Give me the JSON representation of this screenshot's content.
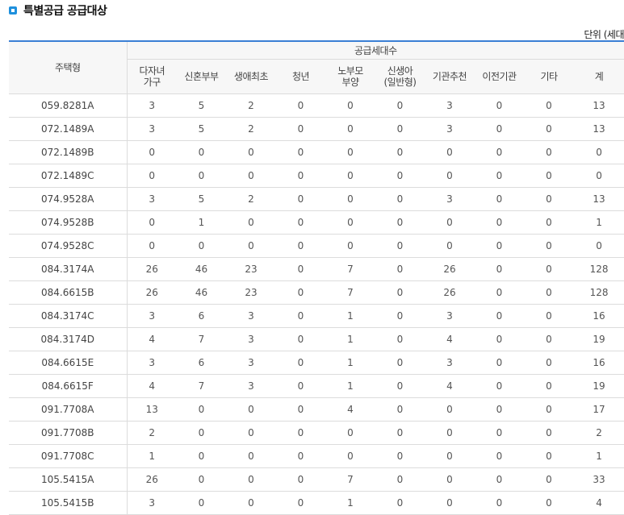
{
  "header": {
    "title": "특별공급 공급대상",
    "unit": "단위 (세대"
  },
  "table": {
    "row_header": "주택형",
    "group_header": "공급세대수",
    "columns": [
      [
        "다자녀",
        "가구"
      ],
      [
        "신혼부부"
      ],
      [
        "생애최초"
      ],
      [
        "청년"
      ],
      [
        "노부모",
        "부양"
      ],
      [
        "신생아",
        "(일반형)"
      ],
      [
        "기관추천"
      ],
      [
        "이전기관"
      ],
      [
        "기타"
      ],
      [
        "계"
      ]
    ],
    "rows": [
      {
        "type": "059.8281A",
        "values": [
          "3",
          "5",
          "2",
          "0",
          "0",
          "0",
          "3",
          "0",
          "0",
          "13"
        ]
      },
      {
        "type": "072.1489A",
        "values": [
          "3",
          "5",
          "2",
          "0",
          "0",
          "0",
          "3",
          "0",
          "0",
          "13"
        ]
      },
      {
        "type": "072.1489B",
        "values": [
          "0",
          "0",
          "0",
          "0",
          "0",
          "0",
          "0",
          "0",
          "0",
          "0"
        ]
      },
      {
        "type": "072.1489C",
        "values": [
          "0",
          "0",
          "0",
          "0",
          "0",
          "0",
          "0",
          "0",
          "0",
          "0"
        ]
      },
      {
        "type": "074.9528A",
        "values": [
          "3",
          "5",
          "2",
          "0",
          "0",
          "0",
          "3",
          "0",
          "0",
          "13"
        ]
      },
      {
        "type": "074.9528B",
        "values": [
          "0",
          "1",
          "0",
          "0",
          "0",
          "0",
          "0",
          "0",
          "0",
          "1"
        ]
      },
      {
        "type": "074.9528C",
        "values": [
          "0",
          "0",
          "0",
          "0",
          "0",
          "0",
          "0",
          "0",
          "0",
          "0"
        ]
      },
      {
        "type": "084.3174A",
        "values": [
          "26",
          "46",
          "23",
          "0",
          "7",
          "0",
          "26",
          "0",
          "0",
          "128"
        ]
      },
      {
        "type": "084.6615B",
        "values": [
          "26",
          "46",
          "23",
          "0",
          "7",
          "0",
          "26",
          "0",
          "0",
          "128"
        ]
      },
      {
        "type": "084.3174C",
        "values": [
          "3",
          "6",
          "3",
          "0",
          "1",
          "0",
          "3",
          "0",
          "0",
          "16"
        ]
      },
      {
        "type": "084.3174D",
        "values": [
          "4",
          "7",
          "3",
          "0",
          "1",
          "0",
          "4",
          "0",
          "0",
          "19"
        ]
      },
      {
        "type": "084.6615E",
        "values": [
          "3",
          "6",
          "3",
          "0",
          "1",
          "0",
          "3",
          "0",
          "0",
          "16"
        ]
      },
      {
        "type": "084.6615F",
        "values": [
          "4",
          "7",
          "3",
          "0",
          "1",
          "0",
          "4",
          "0",
          "0",
          "19"
        ]
      },
      {
        "type": "091.7708A",
        "values": [
          "13",
          "0",
          "0",
          "0",
          "4",
          "0",
          "0",
          "0",
          "0",
          "17"
        ]
      },
      {
        "type": "091.7708B",
        "values": [
          "2",
          "0",
          "0",
          "0",
          "0",
          "0",
          "0",
          "0",
          "0",
          "2"
        ]
      },
      {
        "type": "091.7708C",
        "values": [
          "1",
          "0",
          "0",
          "0",
          "0",
          "0",
          "0",
          "0",
          "0",
          "1"
        ]
      },
      {
        "type": "105.5415A",
        "values": [
          "26",
          "0",
          "0",
          "0",
          "7",
          "0",
          "0",
          "0",
          "0",
          "33"
        ]
      },
      {
        "type": "105.5415B",
        "values": [
          "3",
          "0",
          "0",
          "0",
          "1",
          "0",
          "0",
          "0",
          "0",
          "4"
        ]
      }
    ]
  }
}
